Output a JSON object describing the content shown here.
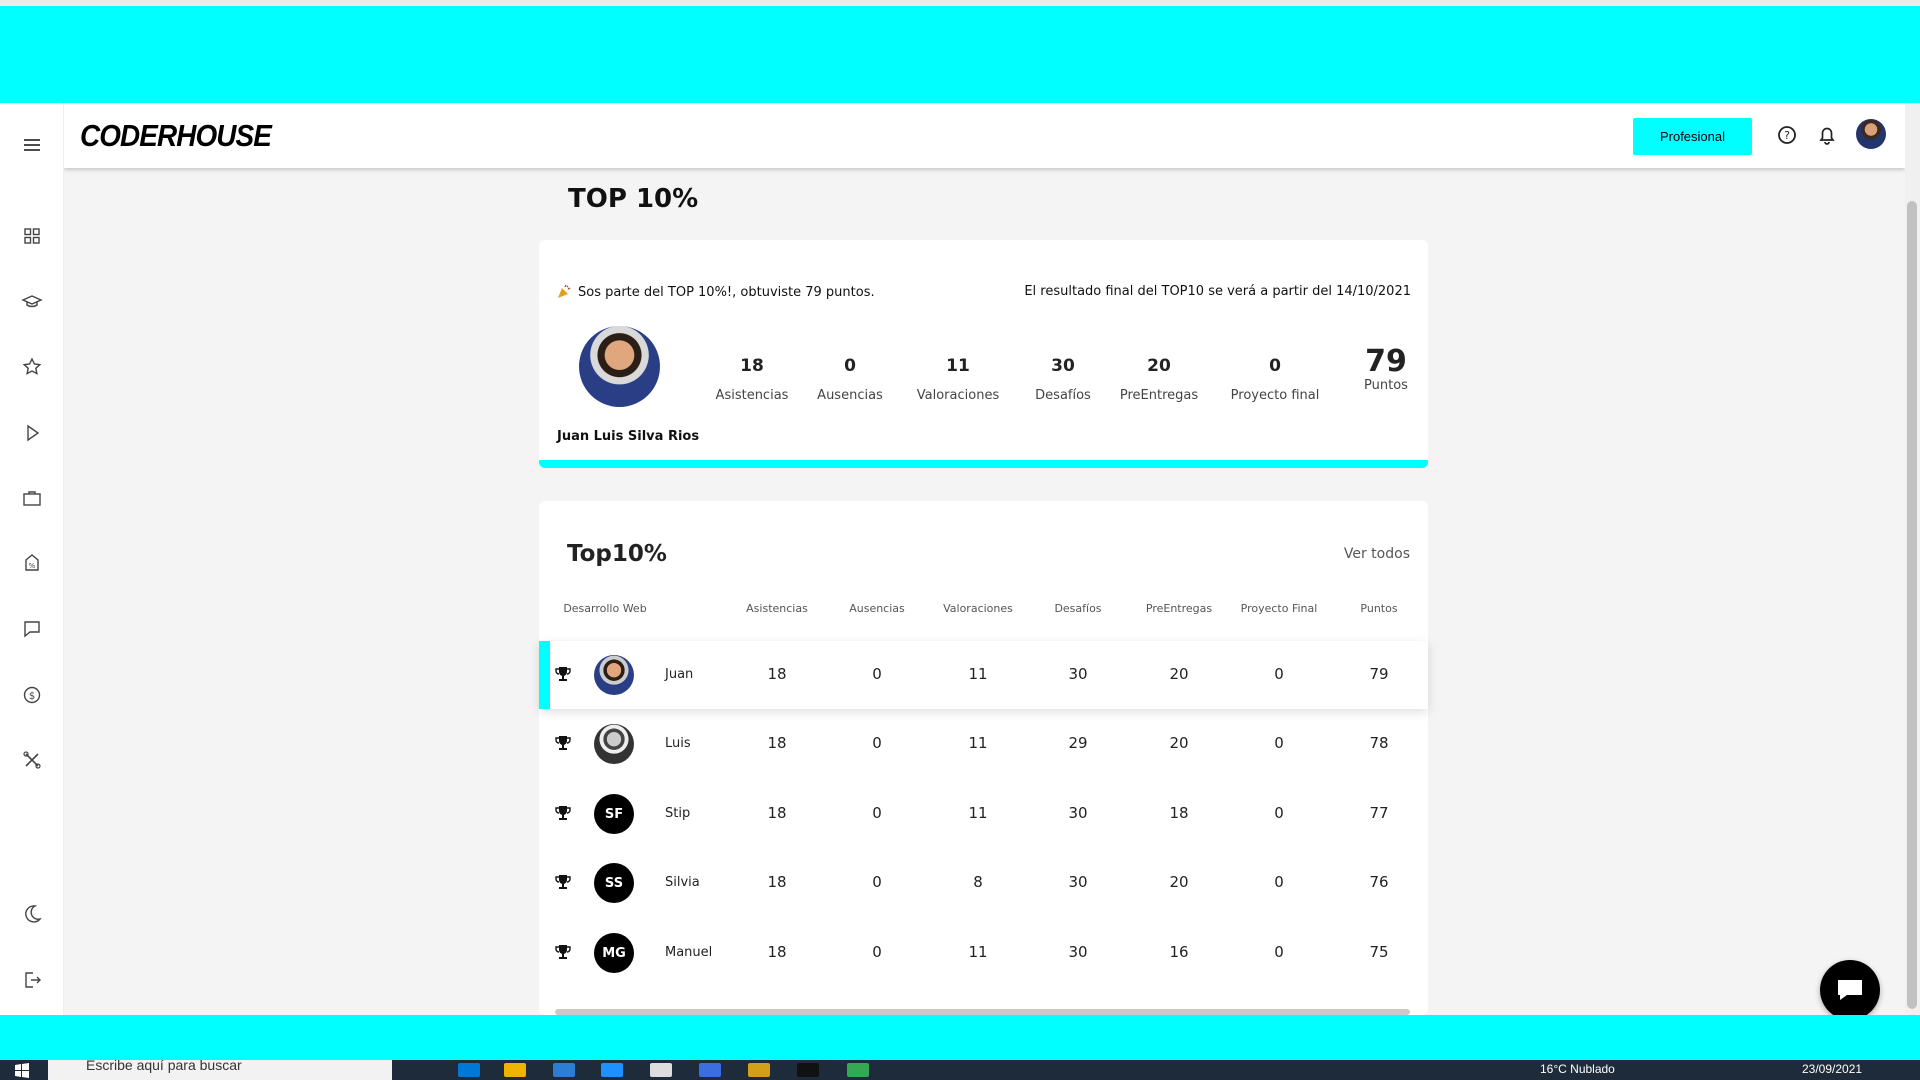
{
  "header": {
    "logo": "CODERHOUSE",
    "plan_button": "Profesional"
  },
  "page_title": "TOP 10%",
  "summary": {
    "message": "Sos parte del TOP 10%!, obtuviste 79 puntos.",
    "notice": "El resultado final del TOP10 se verá a partir del 14/10/2021",
    "user_name": "Juan Luis Silva Rios",
    "stats": [
      {
        "value": "18",
        "label": "Asistencias"
      },
      {
        "value": "0",
        "label": "Ausencias"
      },
      {
        "value": "11",
        "label": "Valoraciones"
      },
      {
        "value": "30",
        "label": "Desafíos"
      },
      {
        "value": "20",
        "label": "PreEntregas"
      },
      {
        "value": "0",
        "label": "Proyecto final"
      },
      {
        "value": "79",
        "label": "Puntos"
      }
    ]
  },
  "ranking": {
    "title": "Top10%",
    "view_all": "Ver todos",
    "columns": [
      "Desarrollo Web",
      "Asistencias",
      "Ausencias",
      "Valoraciones",
      "Desafíos",
      "PreEntregas",
      "Proyecto Final",
      "Puntos"
    ],
    "rows": [
      {
        "name": "Juan",
        "avatar": "photo",
        "initials": "",
        "asistencias": "18",
        "ausencias": "0",
        "valoraciones": "11",
        "desafios": "30",
        "preentregas": "20",
        "proyecto": "0",
        "puntos": "79",
        "active": true
      },
      {
        "name": "Luis",
        "avatar": "photo",
        "initials": "",
        "asistencias": "18",
        "ausencias": "0",
        "valoraciones": "11",
        "desafios": "29",
        "preentregas": "20",
        "proyecto": "0",
        "puntos": "78",
        "active": false
      },
      {
        "name": "Stip",
        "avatar": "initials",
        "initials": "SF",
        "asistencias": "18",
        "ausencias": "0",
        "valoraciones": "11",
        "desafios": "30",
        "preentregas": "18",
        "proyecto": "0",
        "puntos": "77",
        "active": false
      },
      {
        "name": "Silvia",
        "avatar": "initials",
        "initials": "SS",
        "asistencias": "18",
        "ausencias": "0",
        "valoraciones": "8",
        "desafios": "30",
        "preentregas": "20",
        "proyecto": "0",
        "puntos": "76",
        "active": false
      },
      {
        "name": "Manuel",
        "avatar": "initials",
        "initials": "MG",
        "asistencias": "18",
        "ausencias": "0",
        "valoraciones": "11",
        "desafios": "30",
        "preentregas": "16",
        "proyecto": "0",
        "puntos": "75",
        "active": false
      }
    ]
  },
  "sidebar": {
    "icons": [
      "menu-icon",
      "dashboard-icon",
      "graduation-cap-icon",
      "star-icon",
      "play-icon",
      "briefcase-icon",
      "discount-tag-icon",
      "chat-icon",
      "dollar-icon",
      "tools-icon",
      "moon-icon",
      "logout-icon"
    ]
  },
  "taskbar": {
    "search_placeholder": "Escribe aquí para buscar",
    "weather": "16°C  Nublado",
    "date": "23/09/2021"
  },
  "colors": {
    "accent": "#00ffff",
    "text": "#111111"
  }
}
